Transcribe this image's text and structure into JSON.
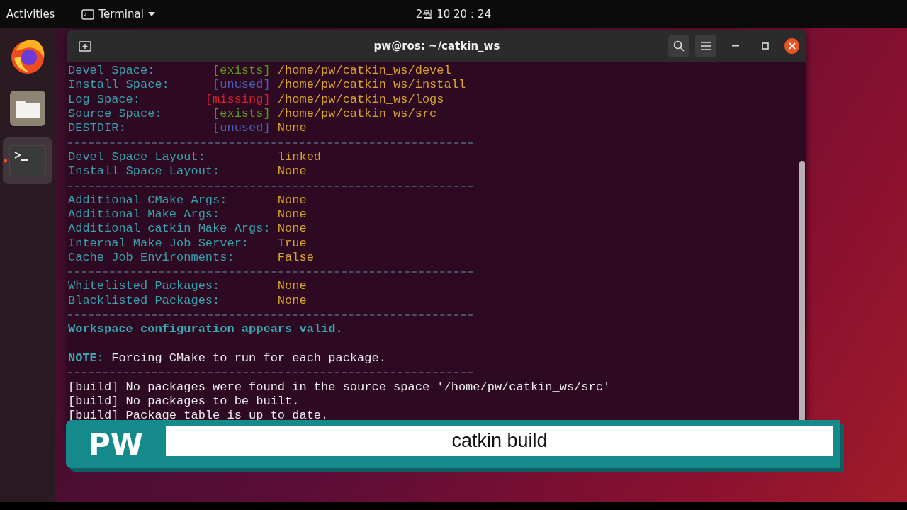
{
  "top_bar": {
    "activities": "Activities",
    "app_menu": "Terminal",
    "clock": "2월 10 20：24"
  },
  "dock": [
    {
      "kind": "browser",
      "selected": false
    },
    {
      "kind": "files",
      "selected": false
    },
    {
      "kind": "terminal",
      "selected": true
    }
  ],
  "terminal": {
    "title": "pw@ros: ~/catkin_ws",
    "lines": [
      {
        "kind": "field",
        "label": "Devel Space:",
        "status": "[exists]",
        "color": "#5a9a1a",
        "value": "/home/pw/catkin_ws/devel"
      },
      {
        "kind": "field",
        "label": "Install Space:",
        "status": "[unused]",
        "color": "#4a5fb0",
        "value": "/home/pw/catkin_ws/install"
      },
      {
        "kind": "field",
        "label": "Log Space:",
        "status": "[missing]",
        "color": "#d0202a",
        "value": "/home/pw/catkin_ws/logs"
      },
      {
        "kind": "field",
        "label": "Source Space:",
        "status": "[exists]",
        "color": "#5a9a1a",
        "value": "/home/pw/catkin_ws/src"
      },
      {
        "kind": "field",
        "label": "DESTDIR:",
        "status": "[unused]",
        "color": "#4a5fb0",
        "value": "None"
      },
      {
        "kind": "rule"
      },
      {
        "kind": "field",
        "label": "Devel Space Layout:",
        "value": "linked"
      },
      {
        "kind": "field",
        "label": "Install Space Layout:",
        "value": "None"
      },
      {
        "kind": "rule"
      },
      {
        "kind": "field",
        "label": "Additional CMake Args:",
        "value": "None"
      },
      {
        "kind": "field",
        "label": "Additional Make Args:",
        "value": "None"
      },
      {
        "kind": "field",
        "label": "Additional catkin Make Args:",
        "value": "None"
      },
      {
        "kind": "field",
        "label": "Internal Make Job Server:",
        "value": "True"
      },
      {
        "kind": "field",
        "label": "Cache Job Environments:",
        "value": "False"
      },
      {
        "kind": "rule"
      },
      {
        "kind": "field",
        "label": "Whitelisted Packages:",
        "value": "None"
      },
      {
        "kind": "field",
        "label": "Blacklisted Packages:",
        "value": "None"
      },
      {
        "kind": "rule"
      },
      {
        "kind": "heading",
        "text": "Workspace configuration appears valid."
      },
      {
        "kind": "blank"
      },
      {
        "kind": "note",
        "tag": "NOTE:",
        "text": "Forcing CMake to run for each package."
      },
      {
        "kind": "rule"
      },
      {
        "kind": "plain",
        "text": "[build] No packages were found in the source space '/home/pw/catkin_ws/src'"
      },
      {
        "kind": "plain",
        "text": "[build] No packages to be built."
      },
      {
        "kind": "plain",
        "text": "[build] Package table is up to date."
      }
    ]
  },
  "caption": {
    "badge": "PW",
    "text": "catkin build"
  }
}
